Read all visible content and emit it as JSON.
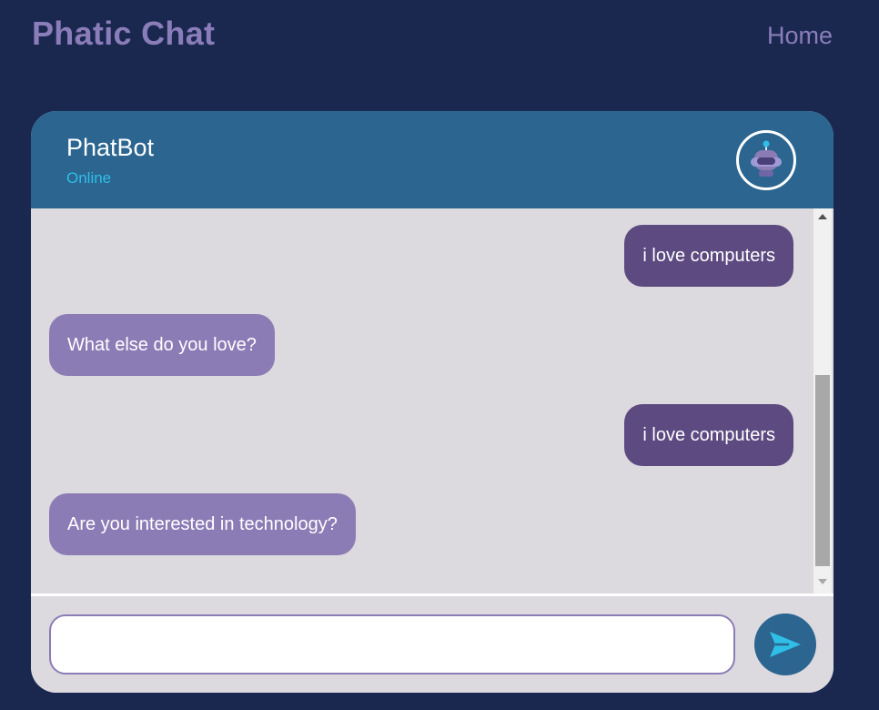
{
  "app": {
    "title": "Phatic Chat",
    "nav": {
      "home_label": "Home"
    }
  },
  "chat": {
    "bot_name": "PhatBot",
    "status": "Online",
    "avatar_icon": "robot-icon",
    "messages": [
      {
        "sender": "user",
        "text": "i love computers"
      },
      {
        "sender": "bot",
        "text": "What else do you love?"
      },
      {
        "sender": "user",
        "text": "i love computers"
      },
      {
        "sender": "bot",
        "text": "Are you interested in technology?"
      }
    ],
    "input": {
      "value": "",
      "placeholder": ""
    },
    "send_icon": "send-icon"
  },
  "colors": {
    "background": "#1a2850",
    "brand_text": "#8a7db9",
    "header": "#2b6590",
    "status": "#2fbfe6",
    "chat_area": "#dcdadf",
    "user_bubble": "#5c4a80",
    "bot_bubble": "#8c7cb5"
  }
}
